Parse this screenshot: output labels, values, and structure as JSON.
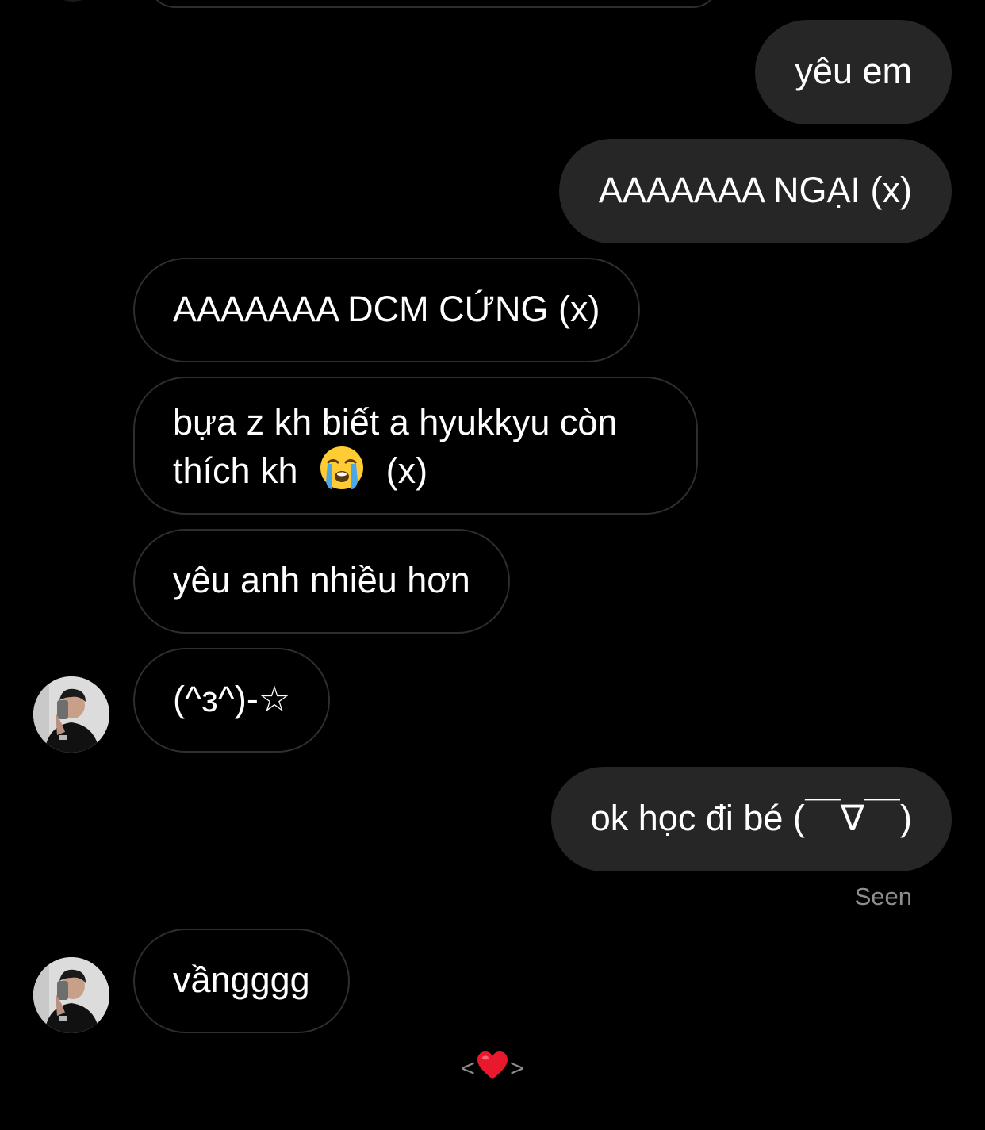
{
  "colors": {
    "background": "#000000",
    "outgoing_bubble": "#262626",
    "incoming_border": "#2e2e2e",
    "text": "#ffffff",
    "muted": "#8e8e8e",
    "heart": "#e8192c"
  },
  "messages": [
    {
      "side": "outgoing",
      "text": "yêu em"
    },
    {
      "side": "outgoing",
      "text": "AAAAAAA NGẠI (x)"
    },
    {
      "side": "incoming",
      "text": "AAAAAAA DCM CỨNG (x)"
    },
    {
      "side": "incoming",
      "text_line1": "bựa z kh biết a hyukkyu còn",
      "text_line2_before": "thích kh",
      "emoji": "loudly-crying-face-icon",
      "text_line2_after": "(x)"
    },
    {
      "side": "incoming",
      "text": "yêu anh nhiều hơn"
    },
    {
      "side": "incoming",
      "text": "(^з^)-☆",
      "avatar": "avatar"
    },
    {
      "side": "outgoing",
      "text": "ok học đi bé (￣∇￣)"
    },
    {
      "side": "incoming",
      "text": "vầngggg",
      "avatar": "avatar"
    }
  ],
  "seen_label": "Seen",
  "reaction": {
    "prev": "<",
    "emoji": "heart-icon",
    "next": ">"
  }
}
